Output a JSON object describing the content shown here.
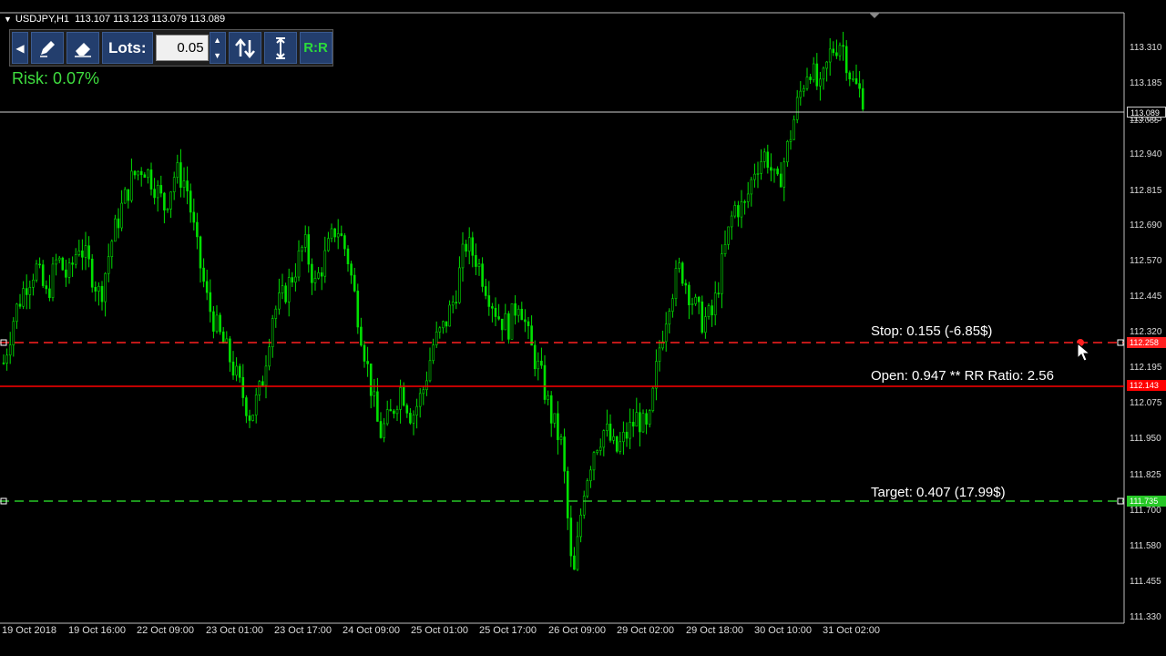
{
  "chart_header": {
    "symbol": "USDJPY,H1",
    "ohlc": "113.107 113.123 113.079 113.089"
  },
  "toolbar": {
    "lots_label": "Lots:",
    "lots_value": "0.05",
    "rr_label": "R:R"
  },
  "risk_label": "Risk: 0.07%",
  "trade_lines": {
    "stop_label": "Stop: 0.155 (-6.85$)",
    "open_label": "Open: 0.947 ** RR Ratio: 2.56",
    "target_label": "Target: 0.407 (17.99$)",
    "stop_price": "112.258",
    "open_price": "112.143",
    "target_price": "111.735",
    "current_price": "113.089",
    "current_price_2": "113.065"
  },
  "colors": {
    "candles": "#00e000",
    "stop": "#ff2020",
    "open": "#ff0000",
    "target": "#27c827",
    "bid_line": "#d0d0d0"
  },
  "chart_data": {
    "type": "candlestick",
    "symbol": "USDJPY",
    "timeframe": "H1",
    "y_ticks": [
      "113.310",
      "113.185",
      "113.065",
      "112.940",
      "112.815",
      "112.690",
      "112.570",
      "112.445",
      "112.320",
      "112.195",
      "112.075",
      "111.950",
      "111.825",
      "111.700",
      "111.580",
      "111.455",
      "111.330"
    ],
    "x_ticks": [
      "19 Oct 2018",
      "19 Oct 16:00",
      "22 Oct 09:00",
      "23 Oct 01:00",
      "23 Oct 17:00",
      "24 Oct 09:00",
      "25 Oct 01:00",
      "25 Oct 17:00",
      "26 Oct 09:00",
      "29 Oct 02:00",
      "29 Oct 18:00",
      "30 Oct 10:00",
      "31 Oct 02:00"
    ],
    "ylim": [
      111.33,
      113.37
    ],
    "close_path": [
      112.2,
      112.36,
      112.46,
      112.52,
      112.42,
      112.55,
      112.48,
      112.6,
      112.52,
      112.42,
      112.6,
      112.72,
      112.82,
      112.86,
      112.8,
      112.72,
      112.84,
      112.8,
      112.58,
      112.4,
      112.3,
      112.22,
      112.12,
      112.02,
      112.12,
      112.36,
      112.42,
      112.5,
      112.6,
      112.46,
      112.56,
      112.66,
      112.56,
      112.36,
      112.16,
      111.96,
      112.02,
      112.12,
      112.02,
      112.1,
      112.26,
      112.32,
      112.42,
      112.6,
      112.55,
      112.45,
      112.36,
      112.32,
      112.42,
      112.26,
      112.16,
      112.02,
      111.92,
      111.45,
      111.78,
      111.92,
      111.98,
      111.9,
      111.96,
      112.02,
      111.96,
      112.24,
      112.42,
      112.52,
      112.42,
      112.34,
      112.36,
      112.55,
      112.72,
      112.72,
      112.86,
      112.9,
      112.78,
      112.92,
      113.08,
      113.2,
      113.1,
      113.24,
      113.28,
      113.14,
      113.09
    ]
  }
}
